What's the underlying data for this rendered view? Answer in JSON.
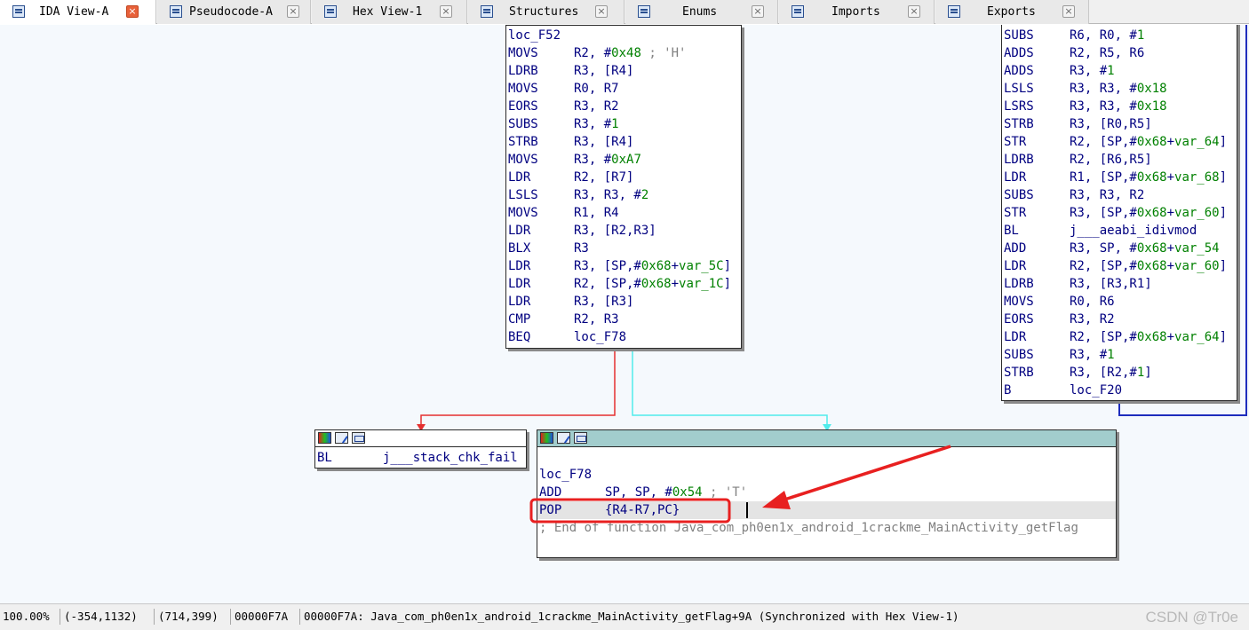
{
  "tabs": [
    {
      "label": "IDA View-A",
      "icon": "ida-view-icon",
      "active": true
    },
    {
      "label": "Pseudocode-A",
      "icon": "pseudocode-icon",
      "active": false
    },
    {
      "label": "Hex View-1",
      "icon": "hex-view-icon",
      "active": false
    },
    {
      "label": "Structures",
      "icon": "structures-icon",
      "active": false
    },
    {
      "label": "Enums",
      "icon": "enums-icon",
      "active": false
    },
    {
      "label": "Imports",
      "icon": "imports-icon",
      "active": false
    },
    {
      "label": "Exports",
      "icon": "exports-icon",
      "active": false
    }
  ],
  "tab_close_glyph": "×",
  "colors": {
    "edge_false": "#e53030",
    "edge_true": "#50ecec",
    "edge_loop": "#1e2dbd",
    "annotation_red": "#e82020",
    "node_header_active": "#a2cdcd",
    "number": "#008000",
    "mnemonic": "#000080",
    "comment": "#808080"
  },
  "blocks": {
    "loc_F52": {
      "label": "loc_F52",
      "lines": [
        {
          "op": "MOVS",
          "args": "R2, #",
          "num": "0x48",
          "rest": " ",
          "comment": "; 'H'"
        },
        {
          "op": "LDRB",
          "args": "R3, [R4]"
        },
        {
          "op": "MOVS",
          "args": "R0, R7"
        },
        {
          "op": "EORS",
          "args": "R3, R2"
        },
        {
          "op": "SUBS",
          "args": "R3, #",
          "num": "1"
        },
        {
          "op": "STRB",
          "args": "R3, [R4]"
        },
        {
          "op": "MOVS",
          "args": "R3, #",
          "num": "0xA7"
        },
        {
          "op": "LDR",
          "args": "R2, [R7]"
        },
        {
          "op": "LSLS",
          "args": "R3, R3, #",
          "num": "2"
        },
        {
          "op": "MOVS",
          "args": "R1, R4"
        },
        {
          "op": "LDR",
          "args": "R3, [R2,R3]"
        },
        {
          "op": "BLX",
          "args": "R3"
        },
        {
          "op": "LDR",
          "args": "R3, [SP,#",
          "num": "0x68",
          "rest": "+",
          "var": "var_5C",
          "tail": "]"
        },
        {
          "op": "LDR",
          "args": "R2, [SP,#",
          "num": "0x68",
          "rest": "+",
          "var": "var_1C",
          "tail": "]"
        },
        {
          "op": "LDR",
          "args": "R3, [R3]"
        },
        {
          "op": "CMP",
          "args": "R2, R3"
        },
        {
          "op": "BEQ",
          "args": "loc_F78"
        }
      ]
    },
    "right_block": {
      "lines": [
        {
          "op": "SUBS",
          "args": "R6, R0, #",
          "num": "1"
        },
        {
          "op": "ADDS",
          "args": "R2, R5, R6"
        },
        {
          "op": "ADDS",
          "args": "R3, #",
          "num": "1"
        },
        {
          "op": "LSLS",
          "args": "R3, R3, #",
          "num": "0x18"
        },
        {
          "op": "LSRS",
          "args": "R3, R3, #",
          "num": "0x18"
        },
        {
          "op": "STRB",
          "args": "R3, [R0,R5]"
        },
        {
          "op": "STR",
          "args": "R2, [SP,#",
          "num": "0x68",
          "rest": "+",
          "var": "var_64",
          "tail": "]"
        },
        {
          "op": "LDRB",
          "args": "R2, [R6,R5]"
        },
        {
          "op": "LDR",
          "args": "R1, [SP,#",
          "num": "0x68",
          "rest": "+",
          "var": "var_68",
          "tail": "]"
        },
        {
          "op": "SUBS",
          "args": "R3, R3, R2"
        },
        {
          "op": "STR",
          "args": "R3, [SP,#",
          "num": "0x68",
          "rest": "+",
          "var": "var_60",
          "tail": "]"
        },
        {
          "op": "BL",
          "args": "j___aeabi_idivmod"
        },
        {
          "op": "ADD",
          "args": "R3, SP, #",
          "num": "0x68",
          "rest": "+",
          "var": "var_54"
        },
        {
          "op": "LDR",
          "args": "R2, [SP,#",
          "num": "0x68",
          "rest": "+",
          "var": "var_60",
          "tail": "]"
        },
        {
          "op": "LDRB",
          "args": "R3, [R3,R1]"
        },
        {
          "op": "MOVS",
          "args": "R0, R6"
        },
        {
          "op": "EORS",
          "args": "R3, R2"
        },
        {
          "op": "LDR",
          "args": "R2, [SP,#",
          "num": "0x68",
          "rest": "+",
          "var": "var_64",
          "tail": "]"
        },
        {
          "op": "SUBS",
          "args": "R3, #",
          "num": "1"
        },
        {
          "op": "STRB",
          "args": "R3, [R2,#",
          "num": "1",
          "rest": "]"
        },
        {
          "op": "B",
          "args": "loc_F20"
        }
      ]
    },
    "stack_fail": {
      "lines": [
        {
          "op": "BL",
          "args": "j___stack_chk_fail"
        }
      ]
    },
    "loc_F78": {
      "label": "loc_F78",
      "lines": [
        {
          "op": "ADD",
          "args": "SP, SP, #",
          "num": "0x54",
          "rest": " ",
          "comment": "; 'T'"
        },
        {
          "op": "POP",
          "args": "{R4-R7,PC}"
        }
      ],
      "end_comment": "; End of function Java_com_ph0en1x_android_1crackme_MainActivity_getFlag"
    }
  },
  "status": {
    "zoom": "100.00%",
    "graph_coords": "(-354,1132)",
    "mouse_coords": "(714,399)",
    "address": "00000F7A",
    "location": "00000F7A: Java_com_ph0en1x_android_1crackme_MainActivity_getFlag+9A (Synchronized with Hex View-1)"
  },
  "watermark": "CSDN @Tr0e"
}
